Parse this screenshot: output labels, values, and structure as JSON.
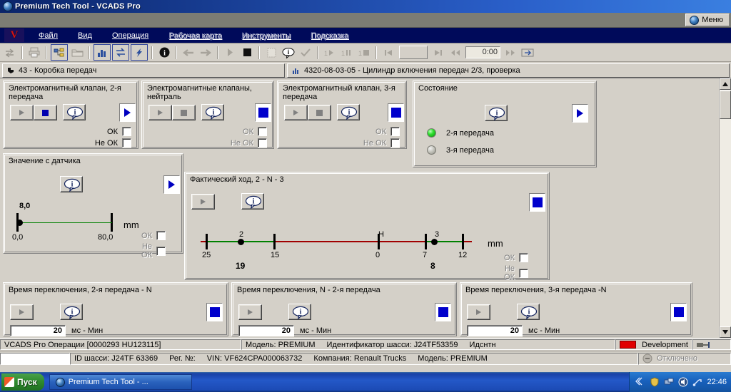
{
  "window": {
    "title": "Premium Tech Tool - VCADS Pro",
    "icon": "globe-icon"
  },
  "menu_button": {
    "label": "Меню",
    "icon": "globe-icon"
  },
  "menubar": {
    "logo": "V",
    "items": [
      {
        "label": "Файл",
        "enabled": true
      },
      {
        "label": "Вид",
        "enabled": true
      },
      {
        "label": "Операция",
        "enabled": true
      },
      {
        "label": "Рабочая карта",
        "enabled": false
      },
      {
        "label": "Инструменты",
        "enabled": false
      },
      {
        "label": "Подсказка",
        "enabled": false
      }
    ]
  },
  "toolbar": {
    "time_value": "0:00",
    "buttons": [
      "transfer-icon",
      "print-icon",
      "chart-tree-icon",
      "folder-icon",
      "bar-chart-icon",
      "swap-icon",
      "lightning-icon",
      "info-icon",
      "back-arrow-icon",
      "forward-arrow-icon",
      "play-icon",
      "stop-icon",
      "blank-page-icon",
      "info-bubble-icon",
      "check-icon",
      "step-play-icon",
      "step-pause-icon",
      "step-stop-icon",
      "skip-start-icon",
      "skip-end-icon",
      "rewind-icon",
      "fast-forward-icon",
      "loop-icon"
    ]
  },
  "tabs": [
    {
      "icon": "arrow-corner-icon",
      "label": "43 - Коробка передач",
      "active": true
    },
    {
      "icon": "bar-chart-icon",
      "label": "4320-08-03-05 - Цилиндр включения передач 2/3, проверка",
      "active": false
    }
  ],
  "panels": {
    "solenoid2": {
      "title": "Электромагнитный клапан, 2-я\nпередача",
      "play_enabled": false,
      "stop_state": "blue",
      "info_icon": "info-bubble-icon",
      "run_state": "blue-arrow",
      "ok_label": "ОК",
      "not_ok_label": "Не ОК",
      "ok_checked": false,
      "not_ok_checked": false,
      "dimmed": false
    },
    "solenoid_neutral": {
      "title": "Электромагнитные клапаны,\nнейтраль",
      "play_enabled": false,
      "stop_state": "gray",
      "info_icon": "info-bubble-icon",
      "run_state": "blue-box",
      "ok_label": "ОК",
      "not_ok_label": "Не ОК",
      "ok_checked": false,
      "not_ok_checked": false,
      "dimmed": true
    },
    "solenoid3": {
      "title": "Электромагнитный клапан, 3-я\nпередача",
      "play_enabled": false,
      "stop_state": "gray",
      "info_icon": "info-bubble-icon",
      "run_state": "blue-box",
      "ok_label": "ОК",
      "not_ok_label": "Не ОК",
      "ok_checked": false,
      "not_ok_checked": false,
      "dimmed": true
    },
    "state": {
      "title": "Состояние",
      "info_icon": "info-bubble-icon",
      "run_state": "blue-arrow",
      "leds": [
        {
          "label": "2-я передача",
          "on": true
        },
        {
          "label": "3-я передача",
          "on": false
        }
      ]
    },
    "sensor": {
      "title": "Значение с датчика",
      "info_icon": "info-bubble-icon",
      "run_state": "blue-arrow",
      "ok_label": "ОК",
      "not_ok_label": "Не ОК",
      "dimmed": true
    },
    "travel": {
      "title": "Фактический ход, 2 - N - 3",
      "play_enabled": false,
      "info_icon": "info-bubble-icon",
      "run_state": "blue-box",
      "ok_label": "ОК",
      "not_ok_label": "Не ОК",
      "dimmed": true
    },
    "switch_2_n": {
      "title": "Время переключения, 2-я передача - N",
      "play_enabled": false,
      "info_icon": "info-bubble-icon",
      "run_state": "blue-box",
      "value": "20",
      "unit": "мс - Мин"
    },
    "switch_n_2": {
      "title": "Время переключения, N - 2-я передача",
      "play_enabled": false,
      "info_icon": "info-bubble-icon",
      "run_state": "blue-box",
      "value": "20",
      "unit": "мс - Мин"
    },
    "switch_3_n": {
      "title": "Время переключения, 3-я передача -N",
      "play_enabled": false,
      "info_icon": "info-bubble-icon",
      "run_state": "blue-box",
      "value": "20",
      "unit": "мс - Мин"
    }
  },
  "chart_data": [
    {
      "type": "scatter",
      "title": "Значение с датчика",
      "unit": "mm",
      "xlabel": "",
      "ylabel": "",
      "xlim": [
        0.0,
        80.0
      ],
      "tick_labels": [
        "0,0",
        "80,0"
      ],
      "values": [
        8.0
      ],
      "value_labels": [
        "8,0"
      ],
      "grid": false,
      "segments": [
        {
          "from": 0.0,
          "to": 80.0,
          "color": "#008000"
        }
      ]
    },
    {
      "type": "scatter",
      "title": "Фактический ход, 2 - N - 3",
      "unit": "mm",
      "xlabel": "",
      "ylabel": "",
      "tick_labels": [
        "25",
        "15",
        "0",
        "7",
        "12"
      ],
      "zone_labels": [
        "2",
        "H",
        "3"
      ],
      "values": [
        19,
        8
      ],
      "value_labels": [
        "19",
        "8"
      ],
      "grid": false,
      "segments": [
        {
          "color": "#008000",
          "label": "2 zone"
        },
        {
          "color": "#a00000",
          "label": "mid zone"
        },
        {
          "color": "#008000",
          "label": "3 zone"
        }
      ]
    }
  ],
  "statusbar_top": {
    "left": "VCADS Pro    Операции    [0000293 HU123115]",
    "model": "Модель: PREMIUM",
    "chassis": "Идентификатор шасси: J24TF53359",
    "ident": "Идснтн",
    "dev_label": "Development",
    "dev_color": "#e00000",
    "plug_icon": "plug-icon"
  },
  "statusbar_bottom": {
    "chassis_id": "ID шасси: J24TF 63369",
    "reg": "Рег. №:",
    "vin": "VIN: VF624CPA000063732",
    "company": "Компания: Renault Trucks",
    "model": "Модель: PREMIUM",
    "connection": "Отключено",
    "connection_icon": "disconnected-icon"
  },
  "taskbar": {
    "start_label": "Пуск",
    "items": [
      {
        "label": "Premium Tech Tool - ...",
        "icon": "globe-icon"
      }
    ],
    "clock": "22:46",
    "tray_icons": [
      "chevron-left-icon",
      "shield-icon",
      "network-icon",
      "volume-icon",
      "usb-icon"
    ]
  }
}
